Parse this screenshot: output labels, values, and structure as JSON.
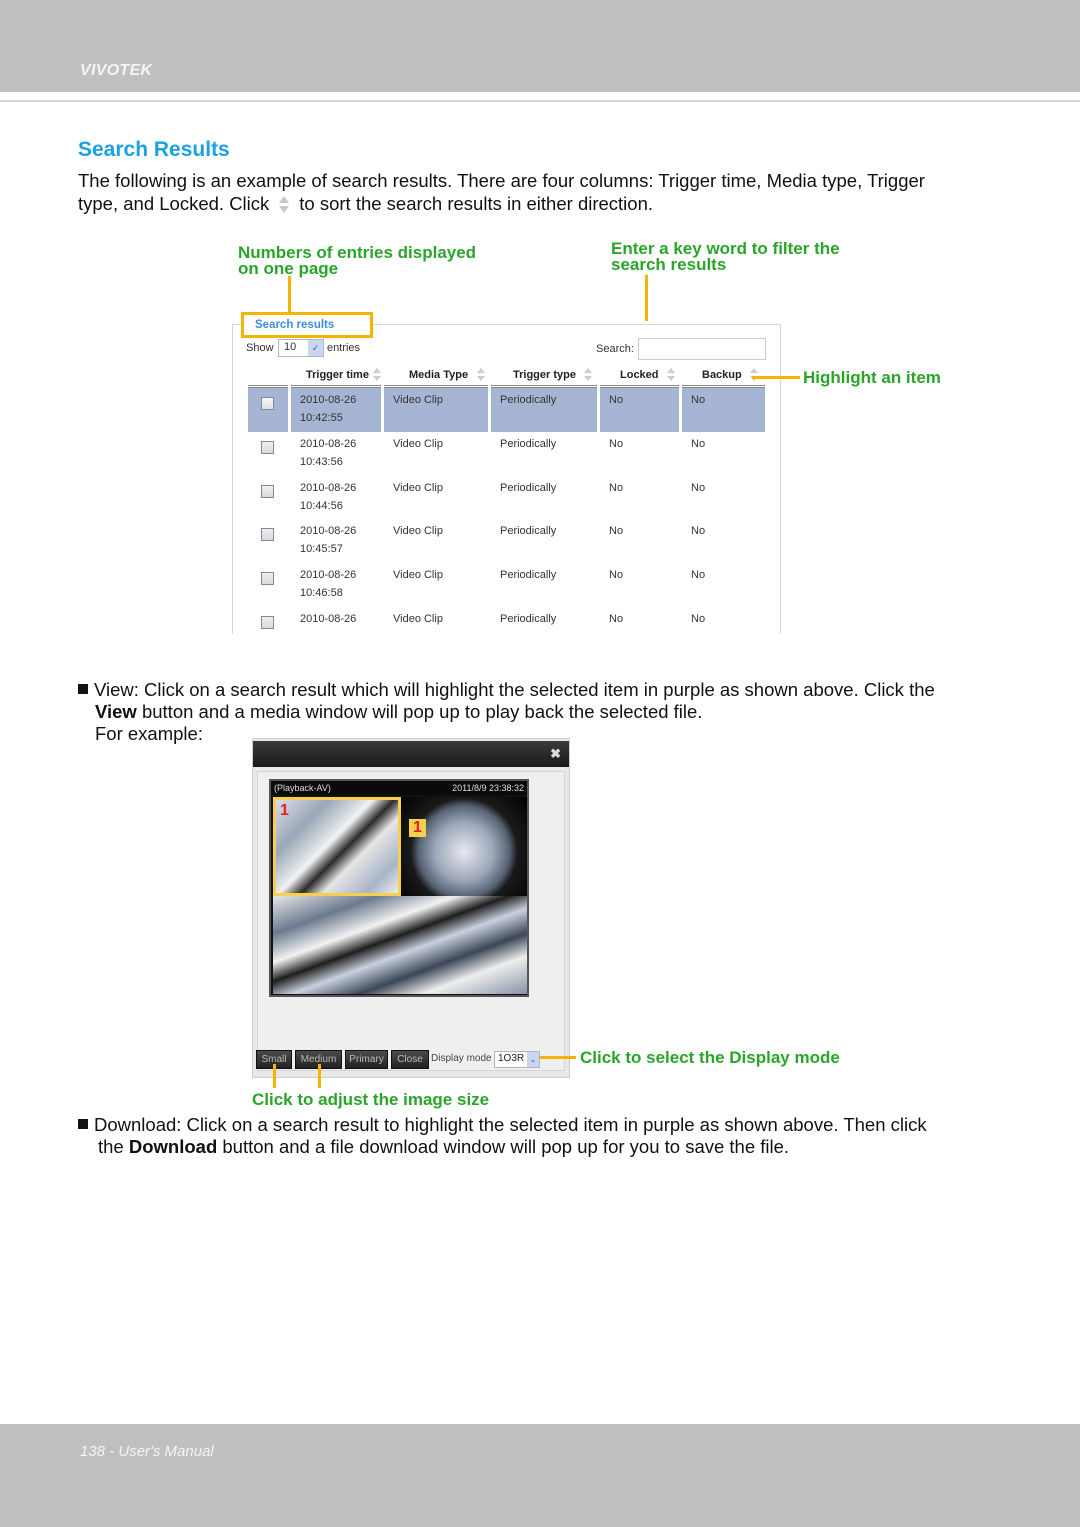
{
  "header": {
    "brand": "VIVOTEK"
  },
  "section": {
    "title": "Search Results",
    "intro_line1": "The following is an example of search results. There are four columns: Trigger time, Media type, Trigger",
    "intro_line2_pre": "type, and Locked. Click",
    "intro_line2_post": "to sort the search results in either direction.",
    "sort_icon": "sort-arrows-icon"
  },
  "annotations": {
    "entries": "Numbers of entries displayed",
    "entries_line2": "on one page",
    "filter": "Enter a key word to filter the",
    "filter_line2": "search results",
    "highlight": "Highlight an item",
    "display_mode": "Click to select the Display mode",
    "image_size": "Click to adjust the image size"
  },
  "search_panel": {
    "legend": "Search results",
    "show_label": "Show",
    "show_value": "10",
    "entries_label": "entries",
    "search_label": "Search:",
    "search_value": "",
    "columns": [
      "Trigger time",
      "Media Type",
      "Trigger type",
      "Locked",
      "Backup"
    ],
    "rows": [
      {
        "date": "2010-08-26",
        "time": "10:42:55",
        "media": "Video Clip",
        "trigger": "Periodically",
        "locked": "No",
        "backup": "No",
        "selected": true
      },
      {
        "date": "2010-08-26",
        "time": "10:43:56",
        "media": "Video Clip",
        "trigger": "Periodically",
        "locked": "No",
        "backup": "No",
        "selected": false
      },
      {
        "date": "2010-08-26",
        "time": "10:44:56",
        "media": "Video Clip",
        "trigger": "Periodically",
        "locked": "No",
        "backup": "No",
        "selected": false
      },
      {
        "date": "2010-08-26",
        "time": "10:45:57",
        "media": "Video Clip",
        "trigger": "Periodically",
        "locked": "No",
        "backup": "No",
        "selected": false
      },
      {
        "date": "2010-08-26",
        "time": "10:46:58",
        "media": "Video Clip",
        "trigger": "Periodically",
        "locked": "No",
        "backup": "No",
        "selected": false
      },
      {
        "date": "2010-08-26",
        "time": "",
        "media": "Video Clip",
        "trigger": "Periodically",
        "locked": "No",
        "backup": "No",
        "selected": false
      }
    ],
    "highlight_color": "#a7b5d4"
  },
  "view_section": {
    "line1": "View: Click on a search result which will highlight the selected item in purple as shown above. Click the",
    "line2_bold": "View",
    "line2_rest": " button and a media window will pop up to play back the selected file.",
    "line3": "For example:"
  },
  "popup": {
    "close_icon": "close-icon",
    "stream_label": "(Playback-AV)",
    "timestamp": "2011/8/9 23:38:32",
    "tile_label_a": "1",
    "tile_label_b": "1",
    "buttons": [
      "Small",
      "Medium",
      "Primary",
      "Close"
    ],
    "display_mode_label": "Display mode",
    "display_mode_value": "1O3R"
  },
  "download_section": {
    "line1": "Download: Click on a search result to highlight the selected item in purple as shown above. Then click",
    "line2_pre": "the ",
    "line2_bold": "Download",
    "line2_rest": " button and a file download window will pop up for you to save the file."
  },
  "footer": {
    "text": "138 - User's Manual"
  },
  "colors": {
    "title_blue": "#1ba1e2",
    "annotation_green": "#2aa52a",
    "callout_orange": "#f5b400",
    "band_gray": "#bfc0bf"
  }
}
